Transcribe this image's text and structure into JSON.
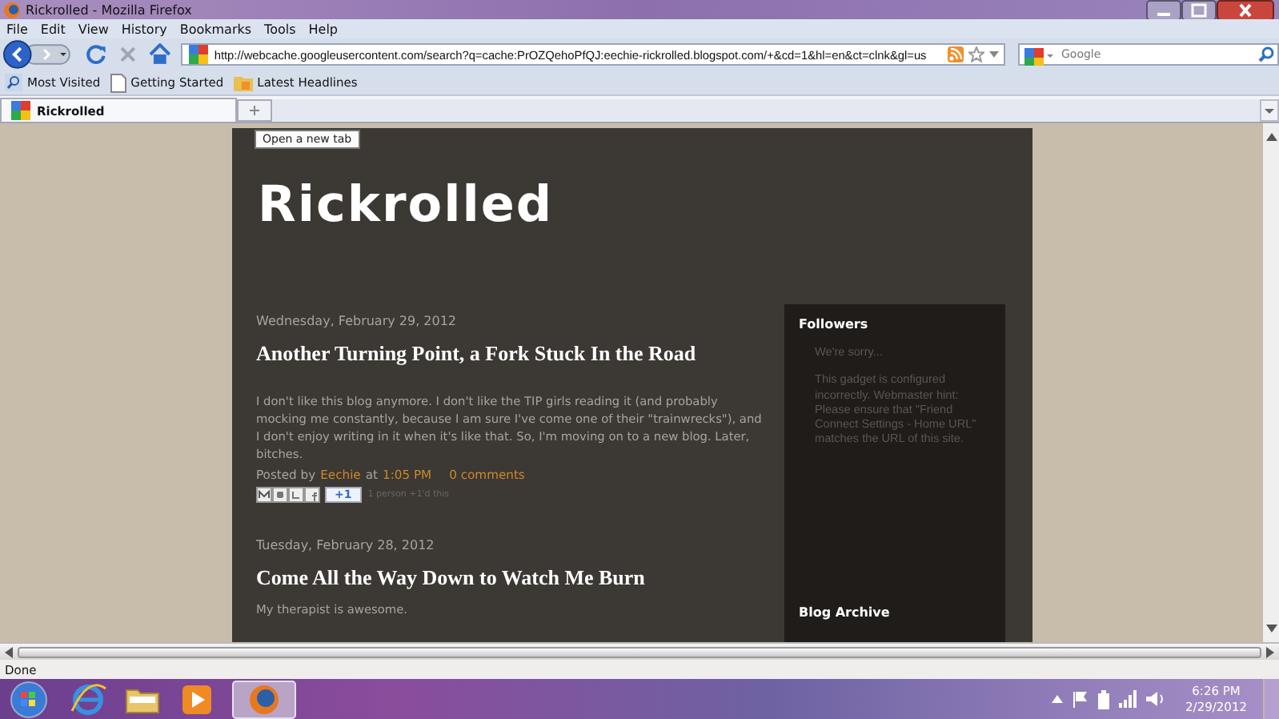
{
  "window": {
    "title": "Rickrolled - Mozilla Firefox"
  },
  "menu": [
    "File",
    "Edit",
    "View",
    "History",
    "Bookmarks",
    "Tools",
    "Help"
  ],
  "toolbar": {
    "url": "http://webcache.googleusercontent.com/search?q=cache:PrOZQehoPfQJ:eechie-rickrolled.blogspot.com/+&cd=1&hl=en&ct=clnk&gl=us",
    "search": {
      "placeholder": "Google"
    }
  },
  "bookmarks": [
    {
      "kind": "smart",
      "label": "Most Visited"
    },
    {
      "kind": "page",
      "label": "Getting Started"
    },
    {
      "kind": "feed",
      "label": "Latest Headlines"
    }
  ],
  "tabs": [
    {
      "label": "Rickrolled",
      "selected": true
    }
  ],
  "tooltip": "Open a new tab",
  "blog": {
    "title": "Rickrolled",
    "posts": [
      {
        "date": "Wednesday, February 29, 2012",
        "title": "Another Turning Point, a Fork Stuck In the Road",
        "body": "I don't like this blog anymore. I don't like the TIP girls reading it (and probably mocking me constantly, because I am sure I've come one of their \"trainwrecks\"), and I don't enjoy writing in it when it's like that. So, I'm moving on to a new blog. Later, bitches.",
        "footer": {
          "posted_by": "Posted by",
          "author": "Eechie",
          "at": "at",
          "time": "1:05 PM",
          "comments": "0 comments",
          "plus_one": "+1",
          "plus_one_note": "1 person +1'd this"
        }
      },
      {
        "date": "Tuesday, February 28, 2012",
        "title": "Come All the Way Down to Watch Me Burn",
        "body": "My therapist is awesome."
      }
    ],
    "sidebar": [
      {
        "kind": "gadget",
        "title": "Followers",
        "lines": [
          "We're sorry...",
          "This gadget is configured incorrectly. Webmaster hint: Please ensure that \"Friend Connect Settings - Home URL\" matches the URL of this site."
        ]
      },
      {
        "kind": "archive",
        "title": "Blog Archive"
      }
    ]
  },
  "status_bar": "Done",
  "taskbar": {
    "time": "6:26 PM",
    "date": "2/29/2012"
  }
}
